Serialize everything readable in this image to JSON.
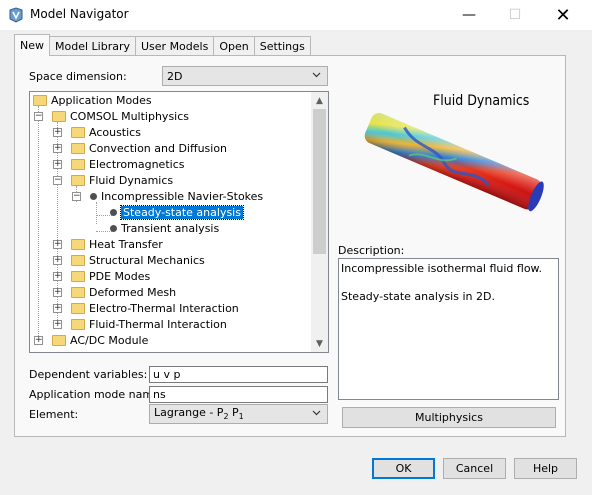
{
  "window": {
    "title": "Model Navigator",
    "minimize": "—",
    "maximize": "☐",
    "close": "✕"
  },
  "tabs": [
    {
      "label": "New",
      "active": true
    },
    {
      "label": "Model Library",
      "active": false
    },
    {
      "label": "User Models",
      "active": false
    },
    {
      "label": "Open",
      "active": false
    },
    {
      "label": "Settings",
      "active": false
    }
  ],
  "space_dimension": {
    "label": "Space dimension:",
    "value": "2D"
  },
  "tree": {
    "items": [
      {
        "label": "Application Modes"
      },
      {
        "label": "COMSOL Multiphysics"
      },
      {
        "label": "Acoustics"
      },
      {
        "label": "Convection and Diffusion"
      },
      {
        "label": "Electromagnetics"
      },
      {
        "label": "Fluid Dynamics"
      },
      {
        "label": "Incompressible Navier-Stokes"
      },
      {
        "label": "Steady-state analysis",
        "selected": true
      },
      {
        "label": "Transient analysis"
      },
      {
        "label": "Heat Transfer"
      },
      {
        "label": "Structural Mechanics"
      },
      {
        "label": "PDE Modes"
      },
      {
        "label": "Deformed Mesh"
      },
      {
        "label": "Electro-Thermal Interaction"
      },
      {
        "label": "Fluid-Thermal Interaction"
      },
      {
        "label": "AC/DC Module"
      }
    ]
  },
  "preview": {
    "title": "Fluid Dynamics"
  },
  "description": {
    "label": "Description:",
    "line1": "Incompressible isothermal fluid flow.",
    "line2": "Steady-state analysis in 2D."
  },
  "dependent_variables": {
    "label": "Dependent variables:",
    "value": "u v p"
  },
  "application_mode_name": {
    "label": "Application mode name:",
    "value": "ns"
  },
  "element": {
    "label": "Element:",
    "value_prefix": "Lagrange - P",
    "sub1": "2",
    "mid": " P",
    "sub2": "1"
  },
  "buttons": {
    "multiphysics": "Multiphysics",
    "ok": "OK",
    "cancel": "Cancel",
    "help": "Help"
  },
  "colors": {
    "accent": "#0078d7",
    "folder": "#f6d77a"
  }
}
